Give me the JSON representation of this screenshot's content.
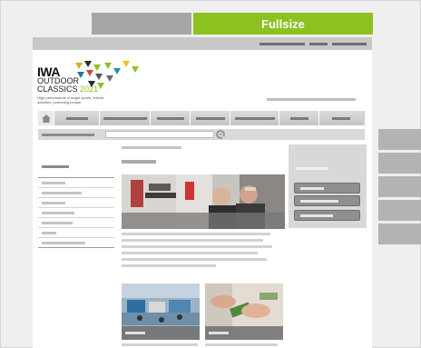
{
  "toggle": {
    "blank_label": "",
    "fullsize_label": "Fullsize",
    "active_color": "#8cc21f"
  },
  "logo": {
    "brand": "IWA",
    "line2": "OUTDOOR",
    "line3_a": "CLASSICS",
    "line3_year": "2021",
    "tagline": "High performance in target sports, leisure activities, protecting people"
  },
  "icons": {
    "home": "home-icon",
    "search": "search-icon"
  },
  "nav": {
    "items": [
      "",
      "",
      "",
      "",
      "",
      "",
      ""
    ]
  },
  "sidebar_tabs": [
    "",
    "",
    "",
    "",
    ""
  ]
}
